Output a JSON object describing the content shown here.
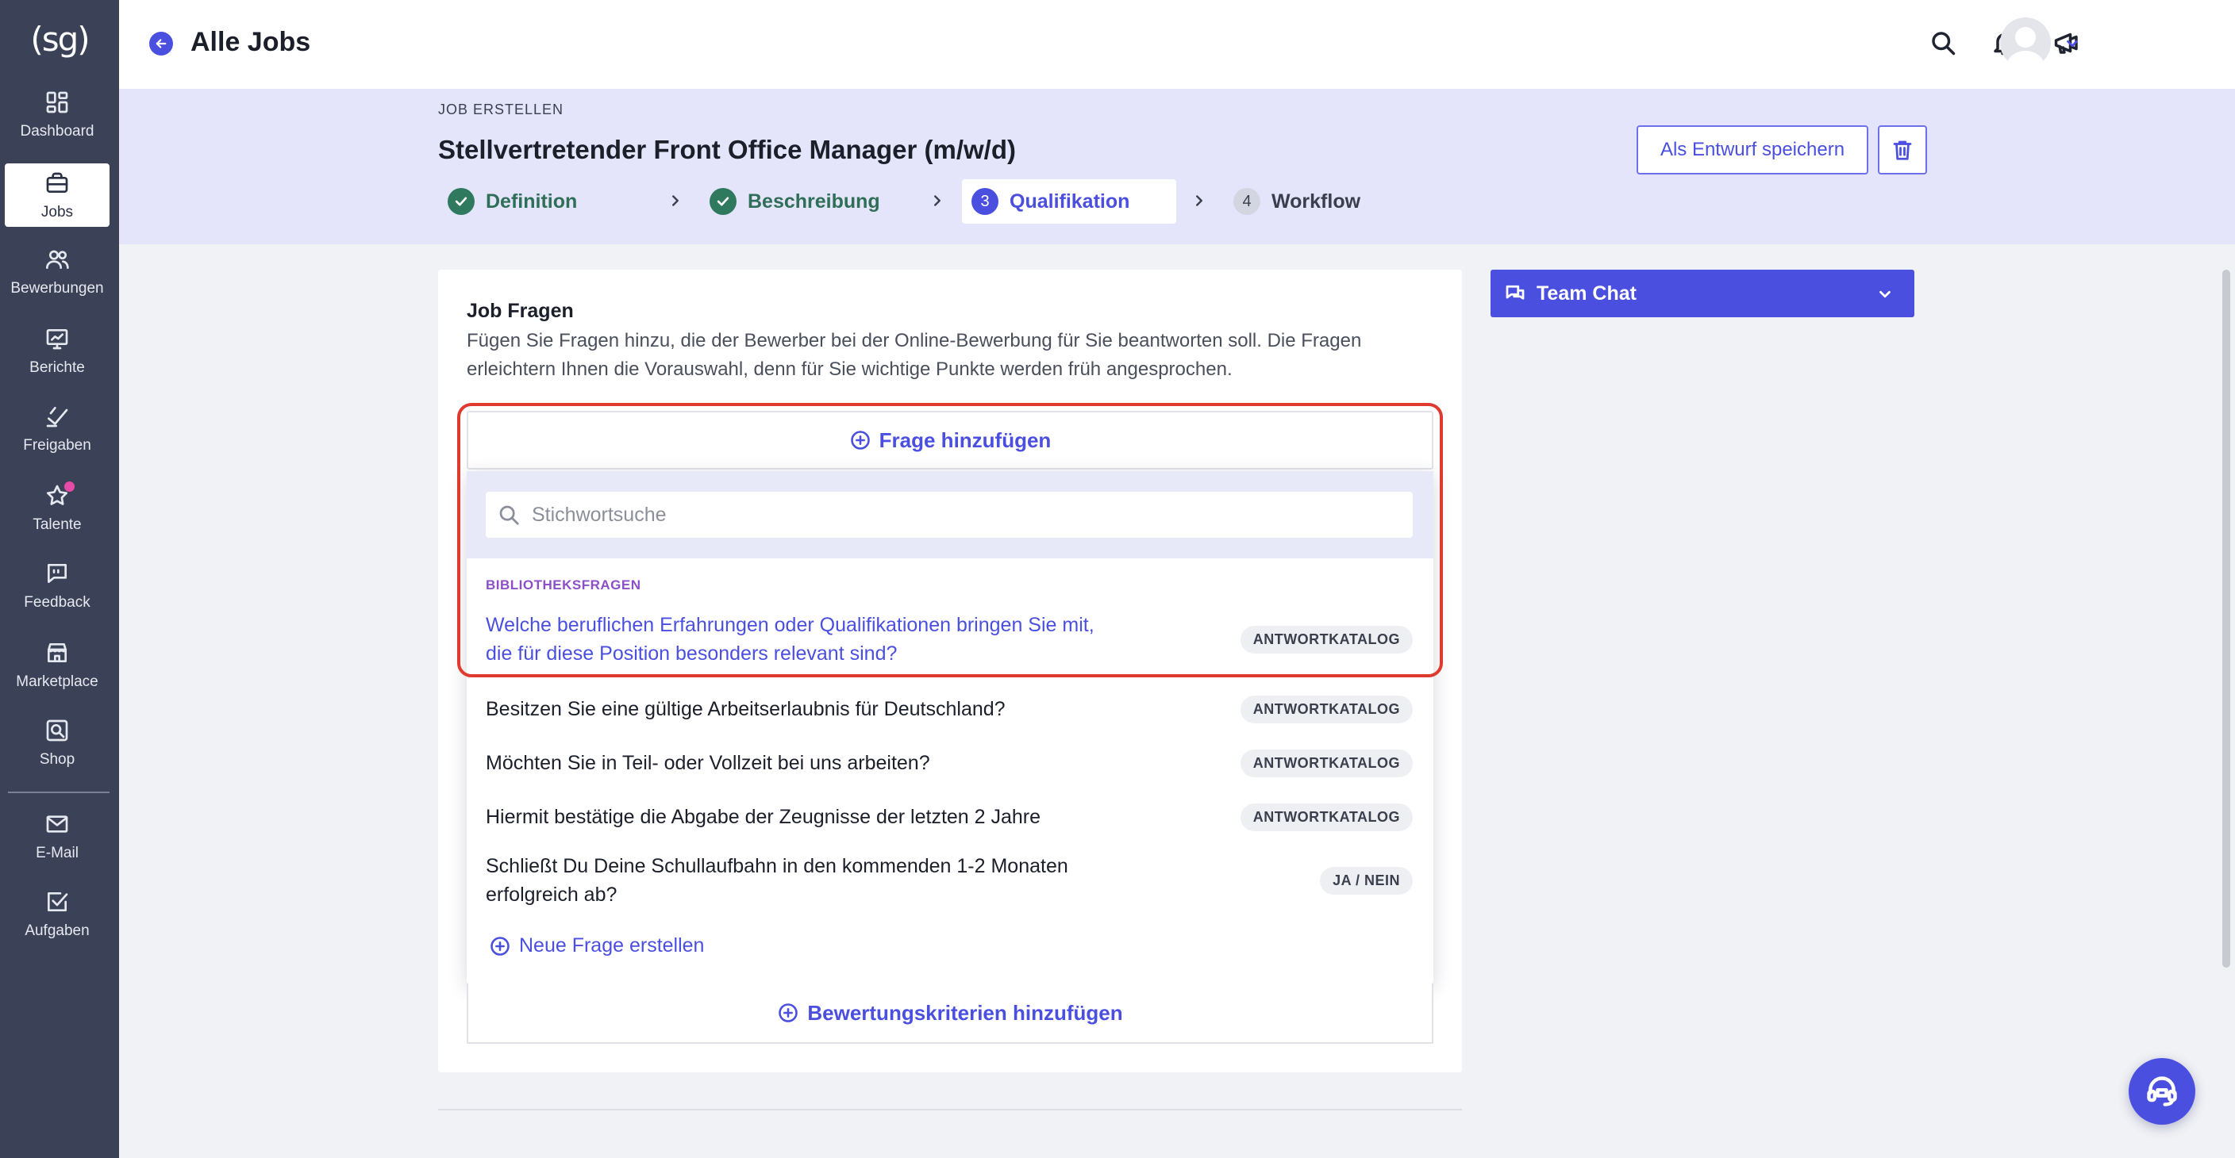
{
  "app": {
    "logo": "(sg)"
  },
  "sidebar": {
    "items": [
      {
        "label": "Dashboard",
        "icon": "dashboard-icon"
      },
      {
        "label": "Jobs",
        "icon": "briefcase-icon",
        "active": true
      },
      {
        "label": "Bewerbungen",
        "icon": "users-icon"
      },
      {
        "label": "Berichte",
        "icon": "chart-icon"
      },
      {
        "label": "Freigaben",
        "icon": "approve-icon"
      },
      {
        "label": "Talente",
        "icon": "star-icon",
        "dot": true
      },
      {
        "label": "Feedback",
        "icon": "feedback-icon"
      },
      {
        "label": "Marketplace",
        "icon": "store-icon"
      },
      {
        "label": "Shop",
        "icon": "shop-icon"
      },
      {
        "label": "E-Mail",
        "icon": "mail-icon"
      },
      {
        "label": "Aufgaben",
        "icon": "tasks-icon"
      }
    ]
  },
  "topbar": {
    "back_title": "Alle Jobs",
    "icons": [
      "search-icon",
      "bell-icon",
      "megaphone-icon",
      "avatar",
      "chevron-down-icon"
    ]
  },
  "header": {
    "overline": "JOB ERSTELLEN",
    "title": "Stellvertretender Front Office Manager (m/w/d)",
    "draft_button": "Als Entwurf speichern",
    "steps": [
      {
        "number": "1",
        "label": "Definition",
        "state": "done"
      },
      {
        "number": "2",
        "label": "Beschreibung",
        "state": "done"
      },
      {
        "number": "3",
        "label": "Qualifikation",
        "state": "current"
      },
      {
        "number": "4",
        "label": "Workflow",
        "state": "todo"
      }
    ]
  },
  "job_questions": {
    "title": "Job Fragen",
    "description": "Fügen Sie Fragen hinzu, die der Bewerber bei der Online-Bewerbung für Sie beantworten soll. Die Fragen erleichtern Ihnen die Vorauswahl, denn für Sie wichtige Punkte werden früh angesprochen.",
    "add_button": "Frage hinzufügen",
    "search_placeholder": "Stichwortsuche",
    "section_label": "BIBLIOTHEKSFRAGEN",
    "questions": [
      {
        "line1": "Welche beruflichen Erfahrungen oder Qualifikationen bringen Sie mit,",
        "line2": "die für diese Position besonders relevant sind?",
        "tag": "ANTWORTKATALOG",
        "highlighted": true
      },
      {
        "line1": "Besitzen Sie eine gültige Arbeitserlaubnis für Deutschland?",
        "line2": "",
        "tag": "ANTWORTKATALOG"
      },
      {
        "line1": "Möchten Sie in Teil- oder Vollzeit bei uns arbeiten?",
        "line2": "",
        "tag": "ANTWORTKATALOG"
      },
      {
        "line1": "Hiermit bestätige die Abgabe der Zeugnisse der letzten 2 Jahre",
        "line2": "",
        "tag": "ANTWORTKATALOG"
      },
      {
        "line1": "Schließt Du Deine Schullaufbahn in den kommenden 1-2 Monaten",
        "line2": "erfolgreich ab?",
        "tag": "JA / NEIN"
      }
    ],
    "new_question": "Neue Frage erstellen",
    "criteria_button": "Bewertungskriterien hinzufügen"
  },
  "team_chat": {
    "label": "Team Chat"
  },
  "colors": {
    "accent": "#4b4fe0",
    "sidebar": "#3b4257",
    "band": "#e4e5fa",
    "done": "#2f7a5f",
    "highlight_outline": "#e03a2f",
    "notification_dot": "#e84aa8"
  }
}
